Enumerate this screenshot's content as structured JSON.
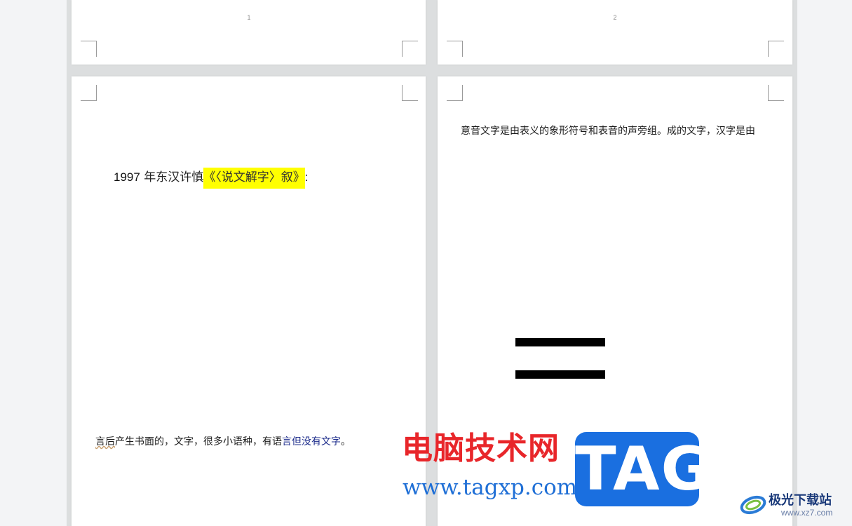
{
  "pages": {
    "page1": {
      "number": "1"
    },
    "page2": {
      "number": "2"
    },
    "page3": {
      "title_year": "1997",
      "title_text": " 年东汉许慎",
      "title_highlight": "《〈说文解字〉叙》",
      "title_colon": ":",
      "bottom_text_wavy": "言后",
      "bottom_text_mid": "产生书面的，文字，很多小语种，有语",
      "bottom_text_blue": "言但没有文字",
      "bottom_text_end": "。"
    },
    "page4": {
      "line_text": "意音文字是由表义的象形符号和表音的声旁组。成的文字，汉字是由"
    }
  },
  "watermark": {
    "brand_cn": "电脑技术网",
    "brand_url": "www.tagxp.com",
    "badge": "TAG",
    "site2_name": "极光下载站",
    "site2_url": "www.xz7.com"
  },
  "colors": {
    "highlight": "#ffff00",
    "brand_red": "#e8262a",
    "brand_blue": "#1a6fe0",
    "page_bg": "#ffffff",
    "gap_bg": "#dcdedf"
  }
}
